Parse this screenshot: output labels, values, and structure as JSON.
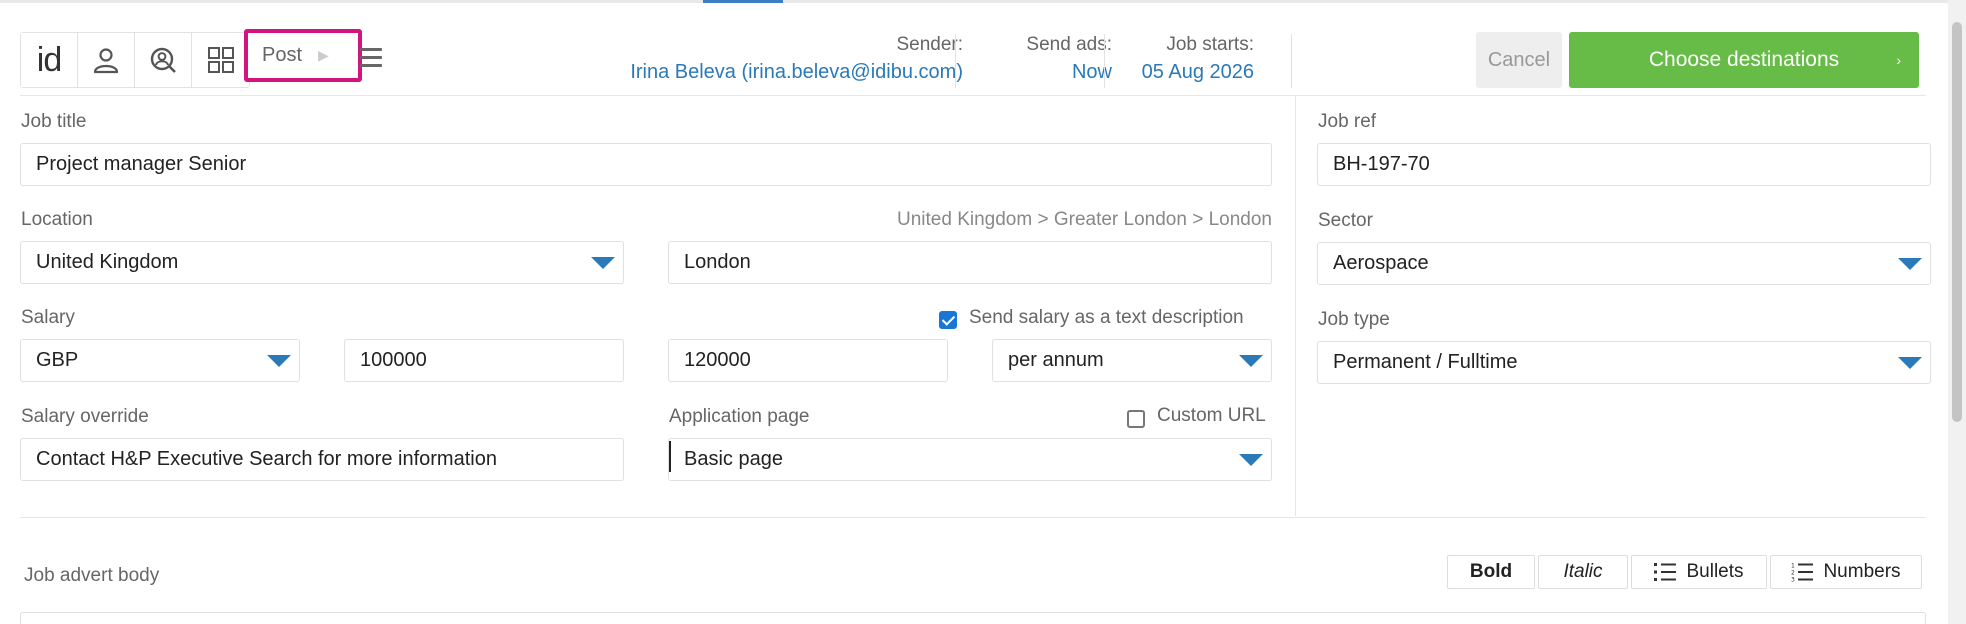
{
  "toolbar": {
    "logo": "id",
    "post_label": "Post",
    "sender_label": "Sender:",
    "sender_value": "Irina Beleva (irina.beleva@idibu.com)",
    "send_ads_label": "Send ads:",
    "send_ads_value": "Now",
    "job_starts_label": "Job starts:",
    "job_starts_value": "05 Aug 2026",
    "cancel_label": "Cancel",
    "choose_label": "Choose destinations",
    "choose_arrow": "›",
    "icons": [
      "user-icon",
      "search-profile-icon",
      "grid-icon",
      "menu-icon"
    ],
    "accent_color": "#66bc46",
    "highlight_color": "#d4147e"
  },
  "form": {
    "job_title_label": "Job title",
    "job_title_value": "Project manager Senior",
    "location_label": "Location",
    "location_breadcrumb": "United Kingdom > Greater London > London",
    "location_country": "United Kingdom",
    "location_city": "London",
    "salary_label": "Salary",
    "salary_text_checkbox_label": "Send salary as a text description",
    "salary_text_checked": true,
    "salary_currency": "GBP",
    "salary_min": "100000",
    "salary_max": "120000",
    "salary_period": "per annum",
    "salary_override_label": "Salary override",
    "salary_override_value": "Contact H&P Executive Search for more information",
    "application_page_label": "Application page",
    "custom_url_label": "Custom URL",
    "custom_url_checked": false,
    "application_page_value": "Basic page",
    "job_ref_label": "Job ref",
    "job_ref_value": "BH-197-70",
    "sector_label": "Sector",
    "sector_value": "Aerospace",
    "job_type_label": "Job type",
    "job_type_value": "Permanent / Fulltime"
  },
  "editor": {
    "body_label": "Job advert body",
    "bold_label": "Bold",
    "italic_label": "Italic",
    "bullets_label": "Bullets",
    "numbers_label": "Numbers"
  }
}
